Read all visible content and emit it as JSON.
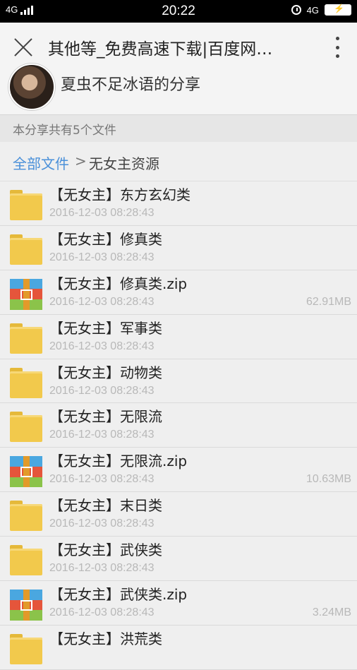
{
  "status_bar": {
    "network_left": "4G",
    "time": "20:22",
    "network_right": "4G"
  },
  "header": {
    "title": "其他等_免费高速下载|百度网…"
  },
  "sharer": {
    "name": "夏虫不足冰语的分享"
  },
  "file_count_text": "本分享共有5个文件",
  "breadcrumb": {
    "root": "全部文件",
    "separator": ">",
    "current": "无女主资源"
  },
  "files": [
    {
      "type": "folder",
      "name": "【无女主】东方玄幻类",
      "date": "2016-12-03 08:28:43",
      "size": ""
    },
    {
      "type": "folder",
      "name": "【无女主】修真类",
      "date": "2016-12-03 08:28:43",
      "size": ""
    },
    {
      "type": "zip",
      "name": "【无女主】修真类.zip",
      "date": "2016-12-03 08:28:43",
      "size": "62.91MB"
    },
    {
      "type": "folder",
      "name": "【无女主】军事类",
      "date": "2016-12-03 08:28:43",
      "size": ""
    },
    {
      "type": "folder",
      "name": "【无女主】动物类",
      "date": "2016-12-03 08:28:43",
      "size": ""
    },
    {
      "type": "folder",
      "name": "【无女主】无限流",
      "date": "2016-12-03 08:28:43",
      "size": ""
    },
    {
      "type": "zip",
      "name": "【无女主】无限流.zip",
      "date": "2016-12-03 08:28:43",
      "size": "10.63MB"
    },
    {
      "type": "folder",
      "name": "【无女主】末日类",
      "date": "2016-12-03 08:28:43",
      "size": ""
    },
    {
      "type": "folder",
      "name": "【无女主】武侠类",
      "date": "2016-12-03 08:28:43",
      "size": ""
    },
    {
      "type": "zip",
      "name": "【无女主】武侠类.zip",
      "date": "2016-12-03 08:28:43",
      "size": "3.24MB"
    },
    {
      "type": "folder",
      "name": "【无女主】洪荒类",
      "date": "",
      "size": ""
    }
  ]
}
